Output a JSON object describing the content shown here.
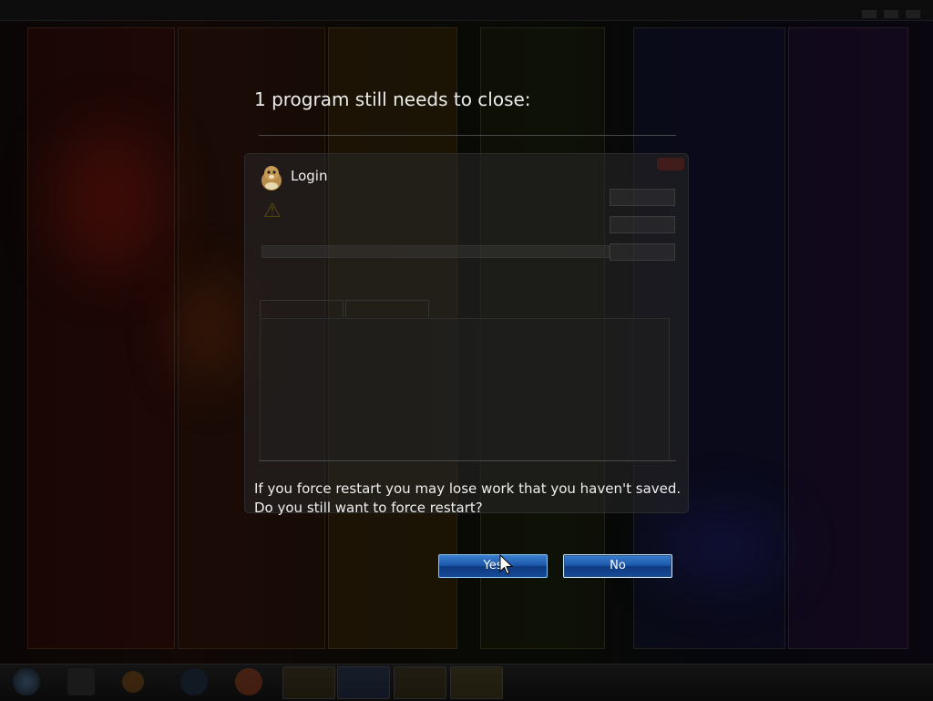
{
  "dialog": {
    "heading": "1 program still needs to close:",
    "program_name": "Login",
    "warning_line1": "If you force restart you may lose work that you haven't saved.",
    "warning_line2": "Do you still want to force restart?",
    "yes_label": "Yes",
    "no_label": "No"
  },
  "colors": {
    "button_blue": "#1b56a8",
    "button_border": "#8ec6f2"
  },
  "icons": [
    "gopher-app-icon",
    "warning-icon",
    "mouse-cursor-icon"
  ]
}
